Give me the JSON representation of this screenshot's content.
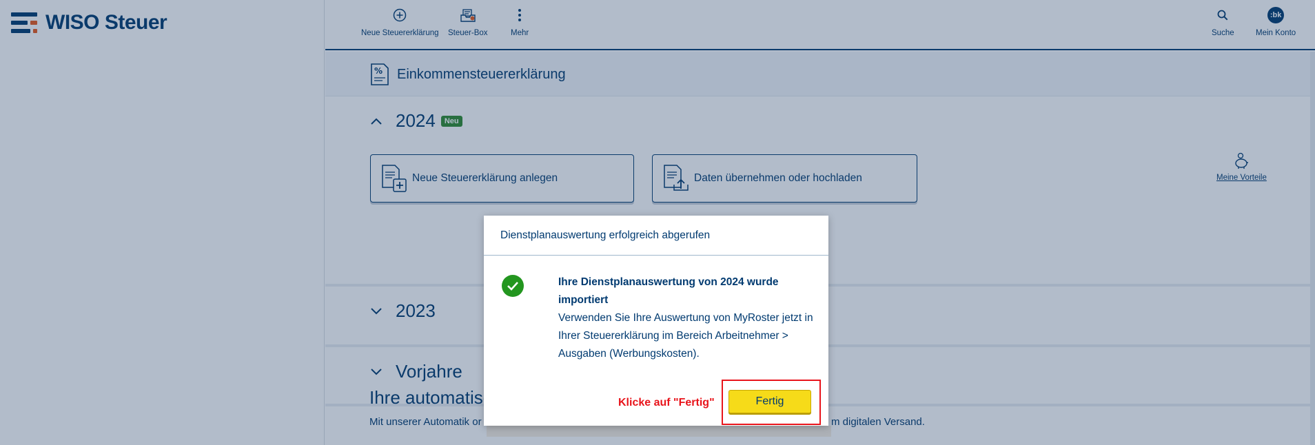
{
  "app": {
    "logo_text": "WISO Steuer"
  },
  "topnav": {
    "items": [
      {
        "label": "Neue Steuererklärung",
        "icon": "plus-circle-icon"
      },
      {
        "label": "Steuer-Box",
        "icon": "inbox-icon"
      },
      {
        "label": "Mehr",
        "icon": "more-vertical-icon"
      }
    ],
    "search_label": "Suche",
    "account_label": "Mein Konto",
    "avatar_initials": ":bk"
  },
  "main": {
    "section_title": "Einkommensteuererklärung",
    "years": [
      {
        "year": "2024",
        "badge": "Neu"
      },
      {
        "year": "2023"
      },
      {
        "year": "Vorjahre"
      }
    ],
    "actions": [
      {
        "label": "Neue Steuererklärung anlegen"
      },
      {
        "label": "Daten übernehmen oder hochladen"
      }
    ],
    "vorteile_label": "Meine Vorteile",
    "auto_title": "Ihre automatisc",
    "auto_text_left": "Mit unserer Automatik or",
    "auto_text_right": "m digitalen Versand."
  },
  "dialog": {
    "title": "Dienstplanauswertung erfolgreich abgerufen",
    "message_bold": "Ihre Dienstplanauswertung von 2024 wurde importiert",
    "message": "Verwenden Sie Ihre Auswertung von MyRoster jetzt in Ihrer Steuererklärung im Bereich Arbeitnehmer > Ausgaben (Werbungskosten).",
    "hint": "Klicke auf \"Fertig\"",
    "done_label": "Fertig"
  },
  "colors": {
    "brand_blue": "#003a70",
    "accent_orange": "#e8591a",
    "success_green": "#23961f",
    "button_yellow": "#f6db19",
    "highlight_red": "#e8141b"
  }
}
